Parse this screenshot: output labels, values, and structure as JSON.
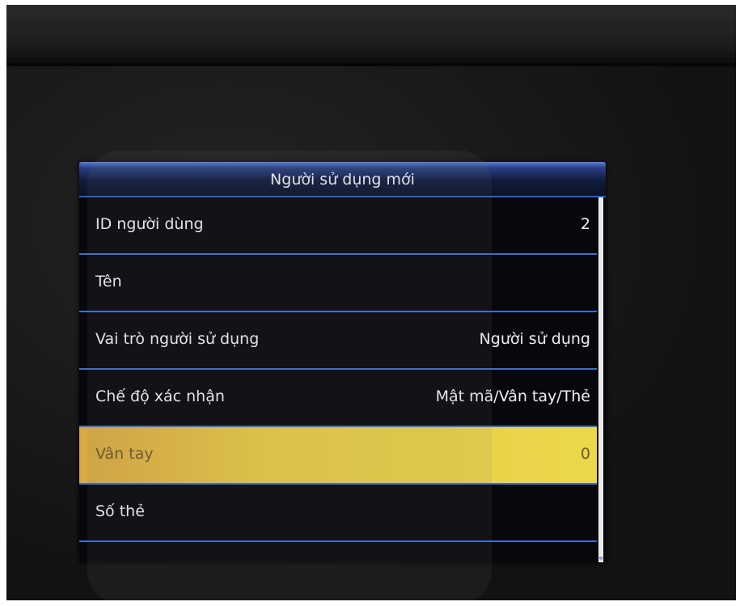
{
  "screen": {
    "title": "Người sử dụng mới"
  },
  "rows": [
    {
      "label": "ID người dùng",
      "value": "2"
    },
    {
      "label": "Tên",
      "value": ""
    },
    {
      "label": "Vai trò người sử dụng",
      "value": "Người sử dụng"
    },
    {
      "label": "Chế độ xác nhận",
      "value": "Mật mã/Vân tay/Thẻ"
    },
    {
      "label": "Vân tay",
      "value": "0",
      "selected": true
    },
    {
      "label": "Số thẻ",
      "value": ""
    }
  ],
  "colors": {
    "selected_row": "#e8c945",
    "divider": "#3b6fd0",
    "background": "#07070c"
  }
}
